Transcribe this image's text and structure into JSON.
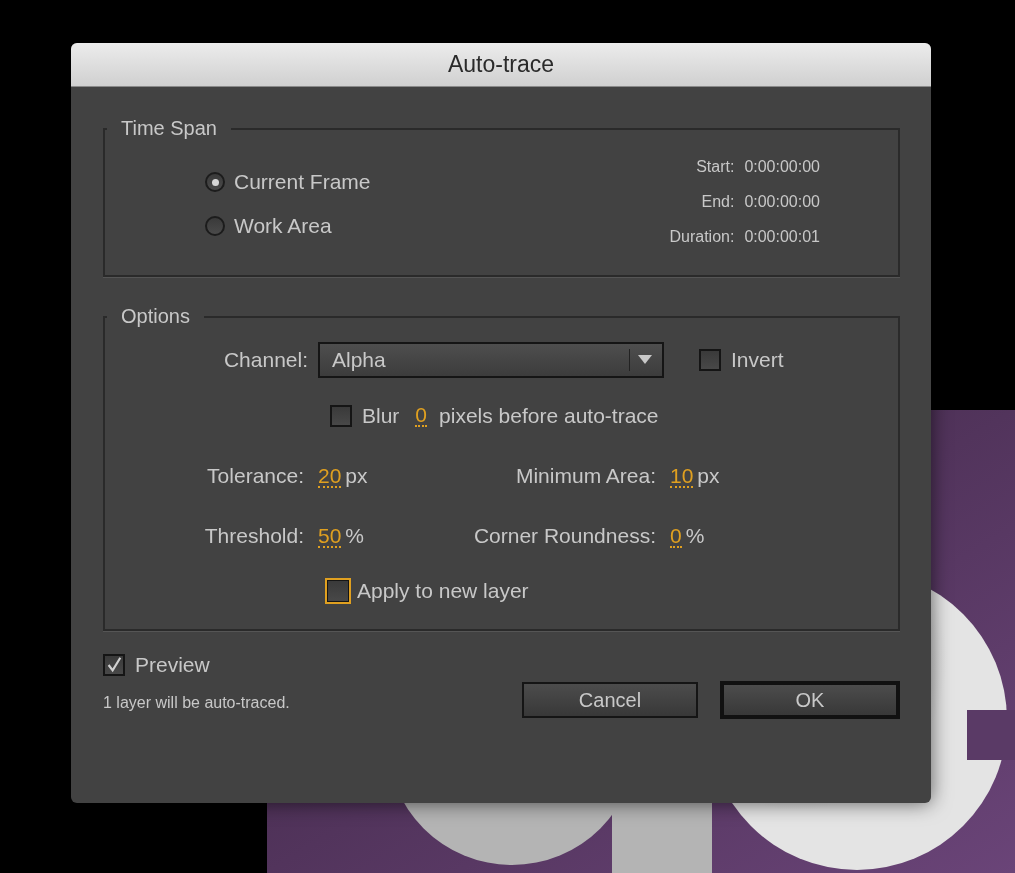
{
  "window": {
    "title": "Auto-trace"
  },
  "time_span": {
    "title": "Time Span",
    "options": [
      {
        "label": "Current Frame",
        "selected": true
      },
      {
        "label": "Work Area",
        "selected": false
      }
    ],
    "info": [
      {
        "label": "Start:",
        "value": "0:00:00:00"
      },
      {
        "label": "End:",
        "value": "0:00:00:00"
      },
      {
        "label": "Duration:",
        "value": "0:00:00:01"
      }
    ]
  },
  "options": {
    "title": "Options",
    "channel": {
      "label": "Channel:",
      "value": "Alpha"
    },
    "invert": {
      "label": "Invert",
      "checked": false
    },
    "blur": {
      "label": "Blur",
      "checked": false,
      "value": "0",
      "suffix": "pixels before auto-trace"
    },
    "params": [
      {
        "label": "Tolerance:",
        "value": "20",
        "unit": "px"
      },
      {
        "label": "Minimum Area:",
        "value": "10",
        "unit": "px"
      },
      {
        "label": "Threshold:",
        "value": "50",
        "unit": "%"
      },
      {
        "label": "Corner Roundness:",
        "value": "0",
        "unit": "%"
      }
    ],
    "apply_new_layer": {
      "label": "Apply to new layer",
      "checked": false,
      "focused": true
    }
  },
  "preview": {
    "label": "Preview",
    "checked": true
  },
  "status": "1 layer will be auto-traced.",
  "buttons": [
    {
      "label": "Cancel",
      "default": false
    },
    {
      "label": "OK",
      "default": true
    }
  ]
}
